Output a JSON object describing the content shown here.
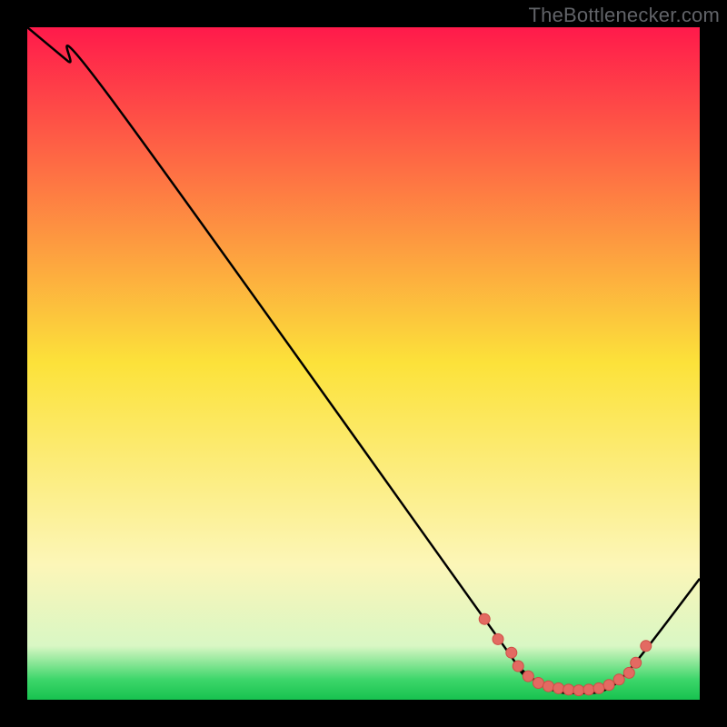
{
  "attribution": "TheBottlenecker.com",
  "chart_data": {
    "type": "line",
    "title": "",
    "xlabel": "",
    "ylabel": "",
    "xlim": [
      0,
      100
    ],
    "ylim": [
      0,
      100
    ],
    "background_gradient": {
      "stops": [
        {
          "pos": 0,
          "color": "#ff1a4b"
        },
        {
          "pos": 0.5,
          "color": "#fce23a"
        },
        {
          "pos": 0.8,
          "color": "#fcf6b8"
        },
        {
          "pos": 0.92,
          "color": "#d9f7c4"
        },
        {
          "pos": 0.97,
          "color": "#3dd66a"
        },
        {
          "pos": 1.0,
          "color": "#17c24f"
        }
      ]
    },
    "series": [
      {
        "name": "bottleneck-curve",
        "x": [
          0,
          6,
          12,
          68,
          73,
          78,
          82,
          86,
          90,
          100
        ],
        "y": [
          100,
          95,
          90,
          12,
          5,
          1.5,
          1,
          1.5,
          5,
          18
        ]
      }
    ],
    "markers": {
      "name": "scatter-markers",
      "x": [
        68,
        70,
        72,
        73,
        74.5,
        76,
        77.5,
        79,
        80.5,
        82,
        83.5,
        85,
        86.5,
        88,
        89.5,
        90.5,
        92
      ],
      "y": [
        12,
        9,
        7,
        5,
        3.5,
        2.5,
        2,
        1.7,
        1.5,
        1.4,
        1.5,
        1.7,
        2.2,
        3,
        4,
        5.5,
        8
      ]
    },
    "marker_style": {
      "fill": "#e36a62",
      "stroke": "#cf4e46",
      "radius": 6
    }
  }
}
